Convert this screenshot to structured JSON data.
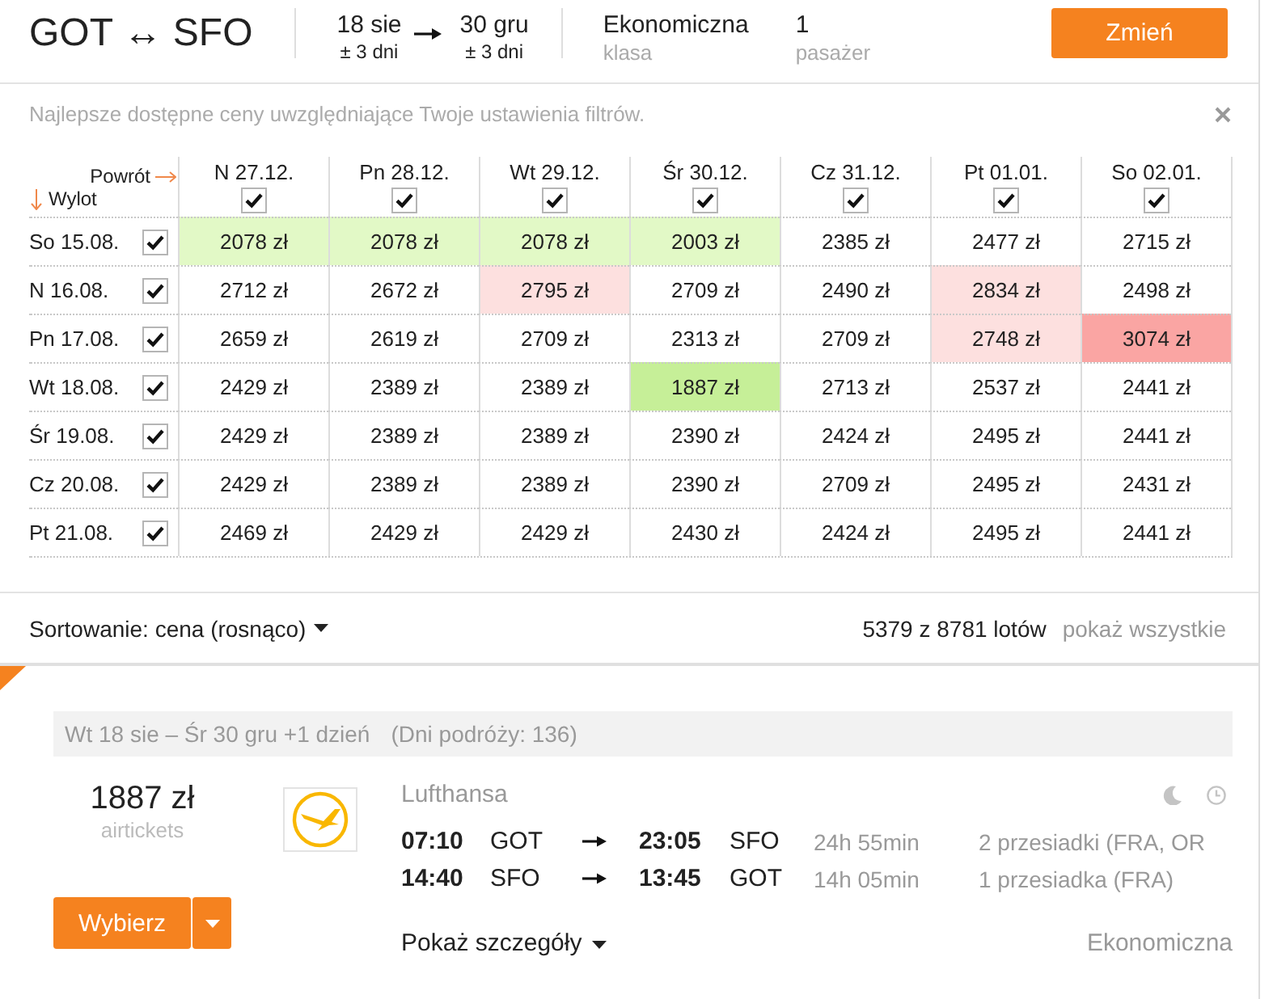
{
  "header": {
    "route": "GOT ↔ SFO",
    "departure": {
      "date": "18 sie",
      "flexibility": "± 3 dni"
    },
    "return": {
      "date": "30 gru",
      "flexibility": "± 3 dni"
    },
    "cabin": {
      "value": "Ekonomiczna",
      "label": "klasa"
    },
    "passengers": {
      "value": "1",
      "label": "pasażer"
    },
    "change_button": "Zmień"
  },
  "notice": {
    "text": "Najlepsze dostępne ceny uwzględniające Twoje ustawienia filtrów."
  },
  "matrix": {
    "return_label": "Powrót",
    "departure_label": "Wylot",
    "columns": [
      {
        "label": "N 27.12.",
        "checked": true
      },
      {
        "label": "Pn 28.12.",
        "checked": true
      },
      {
        "label": "Wt 29.12.",
        "checked": true
      },
      {
        "label": "Śr 30.12.",
        "checked": true
      },
      {
        "label": "Cz 31.12.",
        "checked": true
      },
      {
        "label": "Pt 01.01.",
        "checked": true
      },
      {
        "label": "So 02.01.",
        "checked": true
      }
    ],
    "rows": [
      {
        "label": "So 15.08.",
        "checked": true,
        "cells": [
          {
            "price": "2078 zł",
            "color": "#e2f9c6"
          },
          {
            "price": "2078 zł",
            "color": "#e2f9c6"
          },
          {
            "price": "2078 zł",
            "color": "#e2f9c6"
          },
          {
            "price": "2003 zł",
            "color": "#e2f9c6"
          },
          {
            "price": "2385 zł",
            "color": "#ffffff"
          },
          {
            "price": "2477 zł",
            "color": "#ffffff"
          },
          {
            "price": "2715 zł",
            "color": "#ffffff"
          }
        ]
      },
      {
        "label": "N 16.08.",
        "checked": true,
        "cells": [
          {
            "price": "2712 zł",
            "color": "#ffffff"
          },
          {
            "price": "2672 zł",
            "color": "#ffffff"
          },
          {
            "price": "2795 zł",
            "color": "#fde0df"
          },
          {
            "price": "2709 zł",
            "color": "#ffffff"
          },
          {
            "price": "2490 zł",
            "color": "#ffffff"
          },
          {
            "price": "2834 zł",
            "color": "#fde0df"
          },
          {
            "price": "2498 zł",
            "color": "#ffffff"
          }
        ]
      },
      {
        "label": "Pn 17.08.",
        "checked": true,
        "cells": [
          {
            "price": "2659 zł",
            "color": "#ffffff"
          },
          {
            "price": "2619 zł",
            "color": "#ffffff"
          },
          {
            "price": "2709 zł",
            "color": "#ffffff"
          },
          {
            "price": "2313 zł",
            "color": "#ffffff"
          },
          {
            "price": "2709 zł",
            "color": "#ffffff"
          },
          {
            "price": "2748 zł",
            "color": "#fde0df"
          },
          {
            "price": "3074 zł",
            "color": "#faa5a3"
          }
        ]
      },
      {
        "label": "Wt 18.08.",
        "checked": true,
        "cells": [
          {
            "price": "2429 zł",
            "color": "#ffffff"
          },
          {
            "price": "2389 zł",
            "color": "#ffffff"
          },
          {
            "price": "2389 zł",
            "color": "#ffffff"
          },
          {
            "price": "1887 zł",
            "color": "#c6ef98"
          },
          {
            "price": "2713 zł",
            "color": "#ffffff"
          },
          {
            "price": "2537 zł",
            "color": "#ffffff"
          },
          {
            "price": "2441 zł",
            "color": "#ffffff"
          }
        ]
      },
      {
        "label": "Śr 19.08.",
        "checked": true,
        "cells": [
          {
            "price": "2429 zł",
            "color": "#ffffff"
          },
          {
            "price": "2389 zł",
            "color": "#ffffff"
          },
          {
            "price": "2389 zł",
            "color": "#ffffff"
          },
          {
            "price": "2390 zł",
            "color": "#ffffff"
          },
          {
            "price": "2424 zł",
            "color": "#ffffff"
          },
          {
            "price": "2495 zł",
            "color": "#ffffff"
          },
          {
            "price": "2441 zł",
            "color": "#ffffff"
          }
        ]
      },
      {
        "label": "Cz 20.08.",
        "checked": true,
        "cells": [
          {
            "price": "2429 zł",
            "color": "#ffffff"
          },
          {
            "price": "2389 zł",
            "color": "#ffffff"
          },
          {
            "price": "2389 zł",
            "color": "#ffffff"
          },
          {
            "price": "2390 zł",
            "color": "#ffffff"
          },
          {
            "price": "2709 zł",
            "color": "#ffffff"
          },
          {
            "price": "2495 zł",
            "color": "#ffffff"
          },
          {
            "price": "2431 zł",
            "color": "#ffffff"
          }
        ]
      },
      {
        "label": "Pt 21.08.",
        "checked": true,
        "cells": [
          {
            "price": "2469 zł",
            "color": "#ffffff"
          },
          {
            "price": "2429 zł",
            "color": "#ffffff"
          },
          {
            "price": "2429 zł",
            "color": "#ffffff"
          },
          {
            "price": "2430 zł",
            "color": "#ffffff"
          },
          {
            "price": "2424 zł",
            "color": "#ffffff"
          },
          {
            "price": "2495 zł",
            "color": "#ffffff"
          },
          {
            "price": "2441 zł",
            "color": "#ffffff"
          }
        ]
      }
    ]
  },
  "sort": {
    "label": "Sortowanie: cena (rosnąco)",
    "count": "5379 z 8781 lotów",
    "show_all": "pokaż wszystkie"
  },
  "result": {
    "dates": "Wt 18 sie – Śr 30 gru +1 dzień",
    "trip_length": "(Dni podróży: 136)",
    "price": "1887 zł",
    "seller": "airtickets",
    "airline": "Lufthansa",
    "legs": [
      {
        "departure_time": "07:10",
        "from": "GOT",
        "arrival_time": "23:05",
        "to": "SFO",
        "duration": "24h 55min",
        "stops": "2 przesiadki (FRA, OR"
      },
      {
        "departure_time": "14:40",
        "from": "SFO",
        "arrival_time": "13:45",
        "to": "GOT",
        "duration": "14h 05min",
        "stops": "1 przesiadka (FRA)"
      }
    ],
    "select_button": "Wybierz",
    "details": "Pokaż szczegóły",
    "cabin": "Ekonomiczna"
  }
}
